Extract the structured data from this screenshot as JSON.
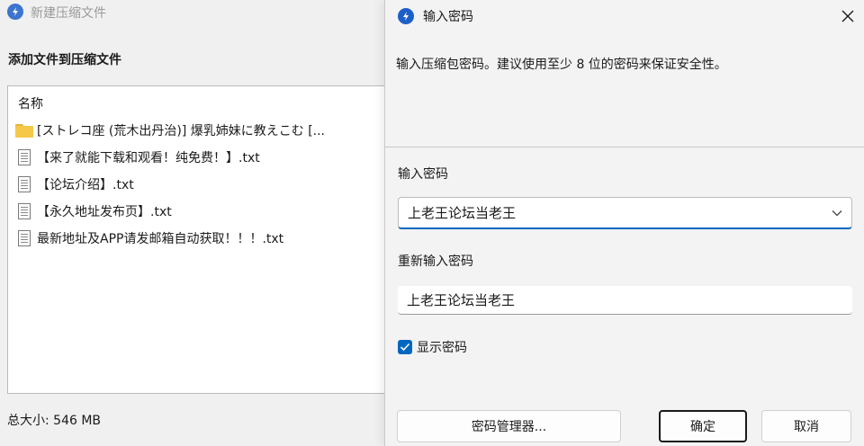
{
  "background_window": {
    "title": "新建压缩文件",
    "heading": "添加文件到压缩文件",
    "list_header": "名称",
    "files": [
      {
        "type": "folder",
        "name": "[ストレコ座 (荒木出丹治)] 爆乳姉妹に教えこむ [..."
      },
      {
        "type": "txt",
        "name": "【来了就能下载和观看！纯免费！】.txt"
      },
      {
        "type": "txt",
        "name": "【论坛介绍】.txt"
      },
      {
        "type": "txt",
        "name": "【永久地址发布页】.txt"
      },
      {
        "type": "txt",
        "name": "最新地址及APP请发邮箱自动获取！！！.txt"
      }
    ],
    "total_size": "总大小: 546 MB"
  },
  "dialog": {
    "title": "输入密码",
    "description": "输入压缩包密码。建议使用至少 8 位的密码来保证安全性。",
    "password_label": "输入密码",
    "password_value": "上老王论坛当老王",
    "confirm_label": "重新输入密码",
    "confirm_value": "上老王论坛当老王",
    "show_password_label": "显示密码",
    "show_password_checked": true,
    "buttons": {
      "password_manager": "密码管理器...",
      "ok": "确定",
      "cancel": "取消"
    }
  },
  "colors": {
    "accent": "#0067c0",
    "logo": "#1d5fc9",
    "folder": "#f6c84a"
  },
  "icons": [
    "app-logo-icon",
    "close-icon",
    "folder-icon",
    "text-file-icon",
    "chevron-down-icon",
    "checkmark-icon"
  ]
}
